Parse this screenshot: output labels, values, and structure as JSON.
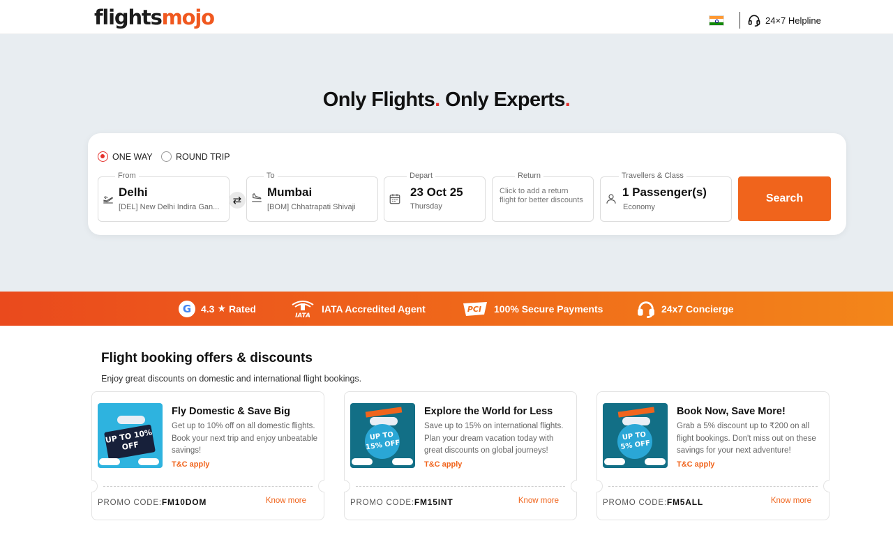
{
  "header": {
    "logo_part1": "flights",
    "logo_part2": "mojo",
    "helpline": "24×7 Helpline"
  },
  "hero": {
    "title_part1": "Only Flights",
    "title_part2": " Only Experts",
    "dot": "."
  },
  "search": {
    "trip_types": [
      "ONE WAY",
      "ROUND TRIP"
    ],
    "selected_trip": "ONE WAY",
    "from": {
      "label": "From",
      "city": "Delhi",
      "airport": "[DEL] New Delhi Indira Gan..."
    },
    "to": {
      "label": "To",
      "city": "Mumbai",
      "airport": "[BOM] Chhatrapati Shivaji"
    },
    "depart": {
      "label": "Depart",
      "date": "23 Oct 25",
      "day": "Thursday"
    },
    "return": {
      "label": "Return",
      "hint": "Click to add a return flight for better discounts"
    },
    "travellers": {
      "label": "Travellers & Class",
      "count": "1 Passenger(s)",
      "class": "Economy"
    },
    "swap_symbol": "⇄",
    "search_button": "Search"
  },
  "trust_bar": {
    "rating": "4.3",
    "rating_suffix": "Rated",
    "iata": "IATA Accredited Agent",
    "secure": "100% Secure Payments",
    "concierge": "24x7 Concierge"
  },
  "offers": {
    "title": "Flight booking offers & discounts",
    "subtitle": "Enjoy great discounts on domestic and international flight bookings.",
    "promo_label": "PROMO CODE:",
    "know_more": "Know more",
    "tc": "T&C apply",
    "cards": [
      {
        "title": "Fly Domestic & Save Big",
        "desc": "Get up to 10% off on all domestic flights. Book your next trip and enjoy unbeatable savings!",
        "code": "FM10DOM",
        "img_text": "UP TO 10% OFF"
      },
      {
        "title": "Explore the World for Less",
        "desc": "Save up to 15% on international flights. Plan your dream vacation today with great discounts on global journeys!",
        "code": "FM15INT",
        "img_text": "UP TO 15% OFF"
      },
      {
        "title": "Book Now, Save More!",
        "desc": "Grab a 5% discount up to ₹200 on all flight bookings. Don't miss out on these savings for your next adventure!",
        "code": "FM5ALL",
        "img_text": "UP TO 5% OFF"
      }
    ]
  },
  "colors": {
    "brand_orange": "#f0641c",
    "accent_red": "#e5322d",
    "hero_bg": "#e8edf1"
  }
}
